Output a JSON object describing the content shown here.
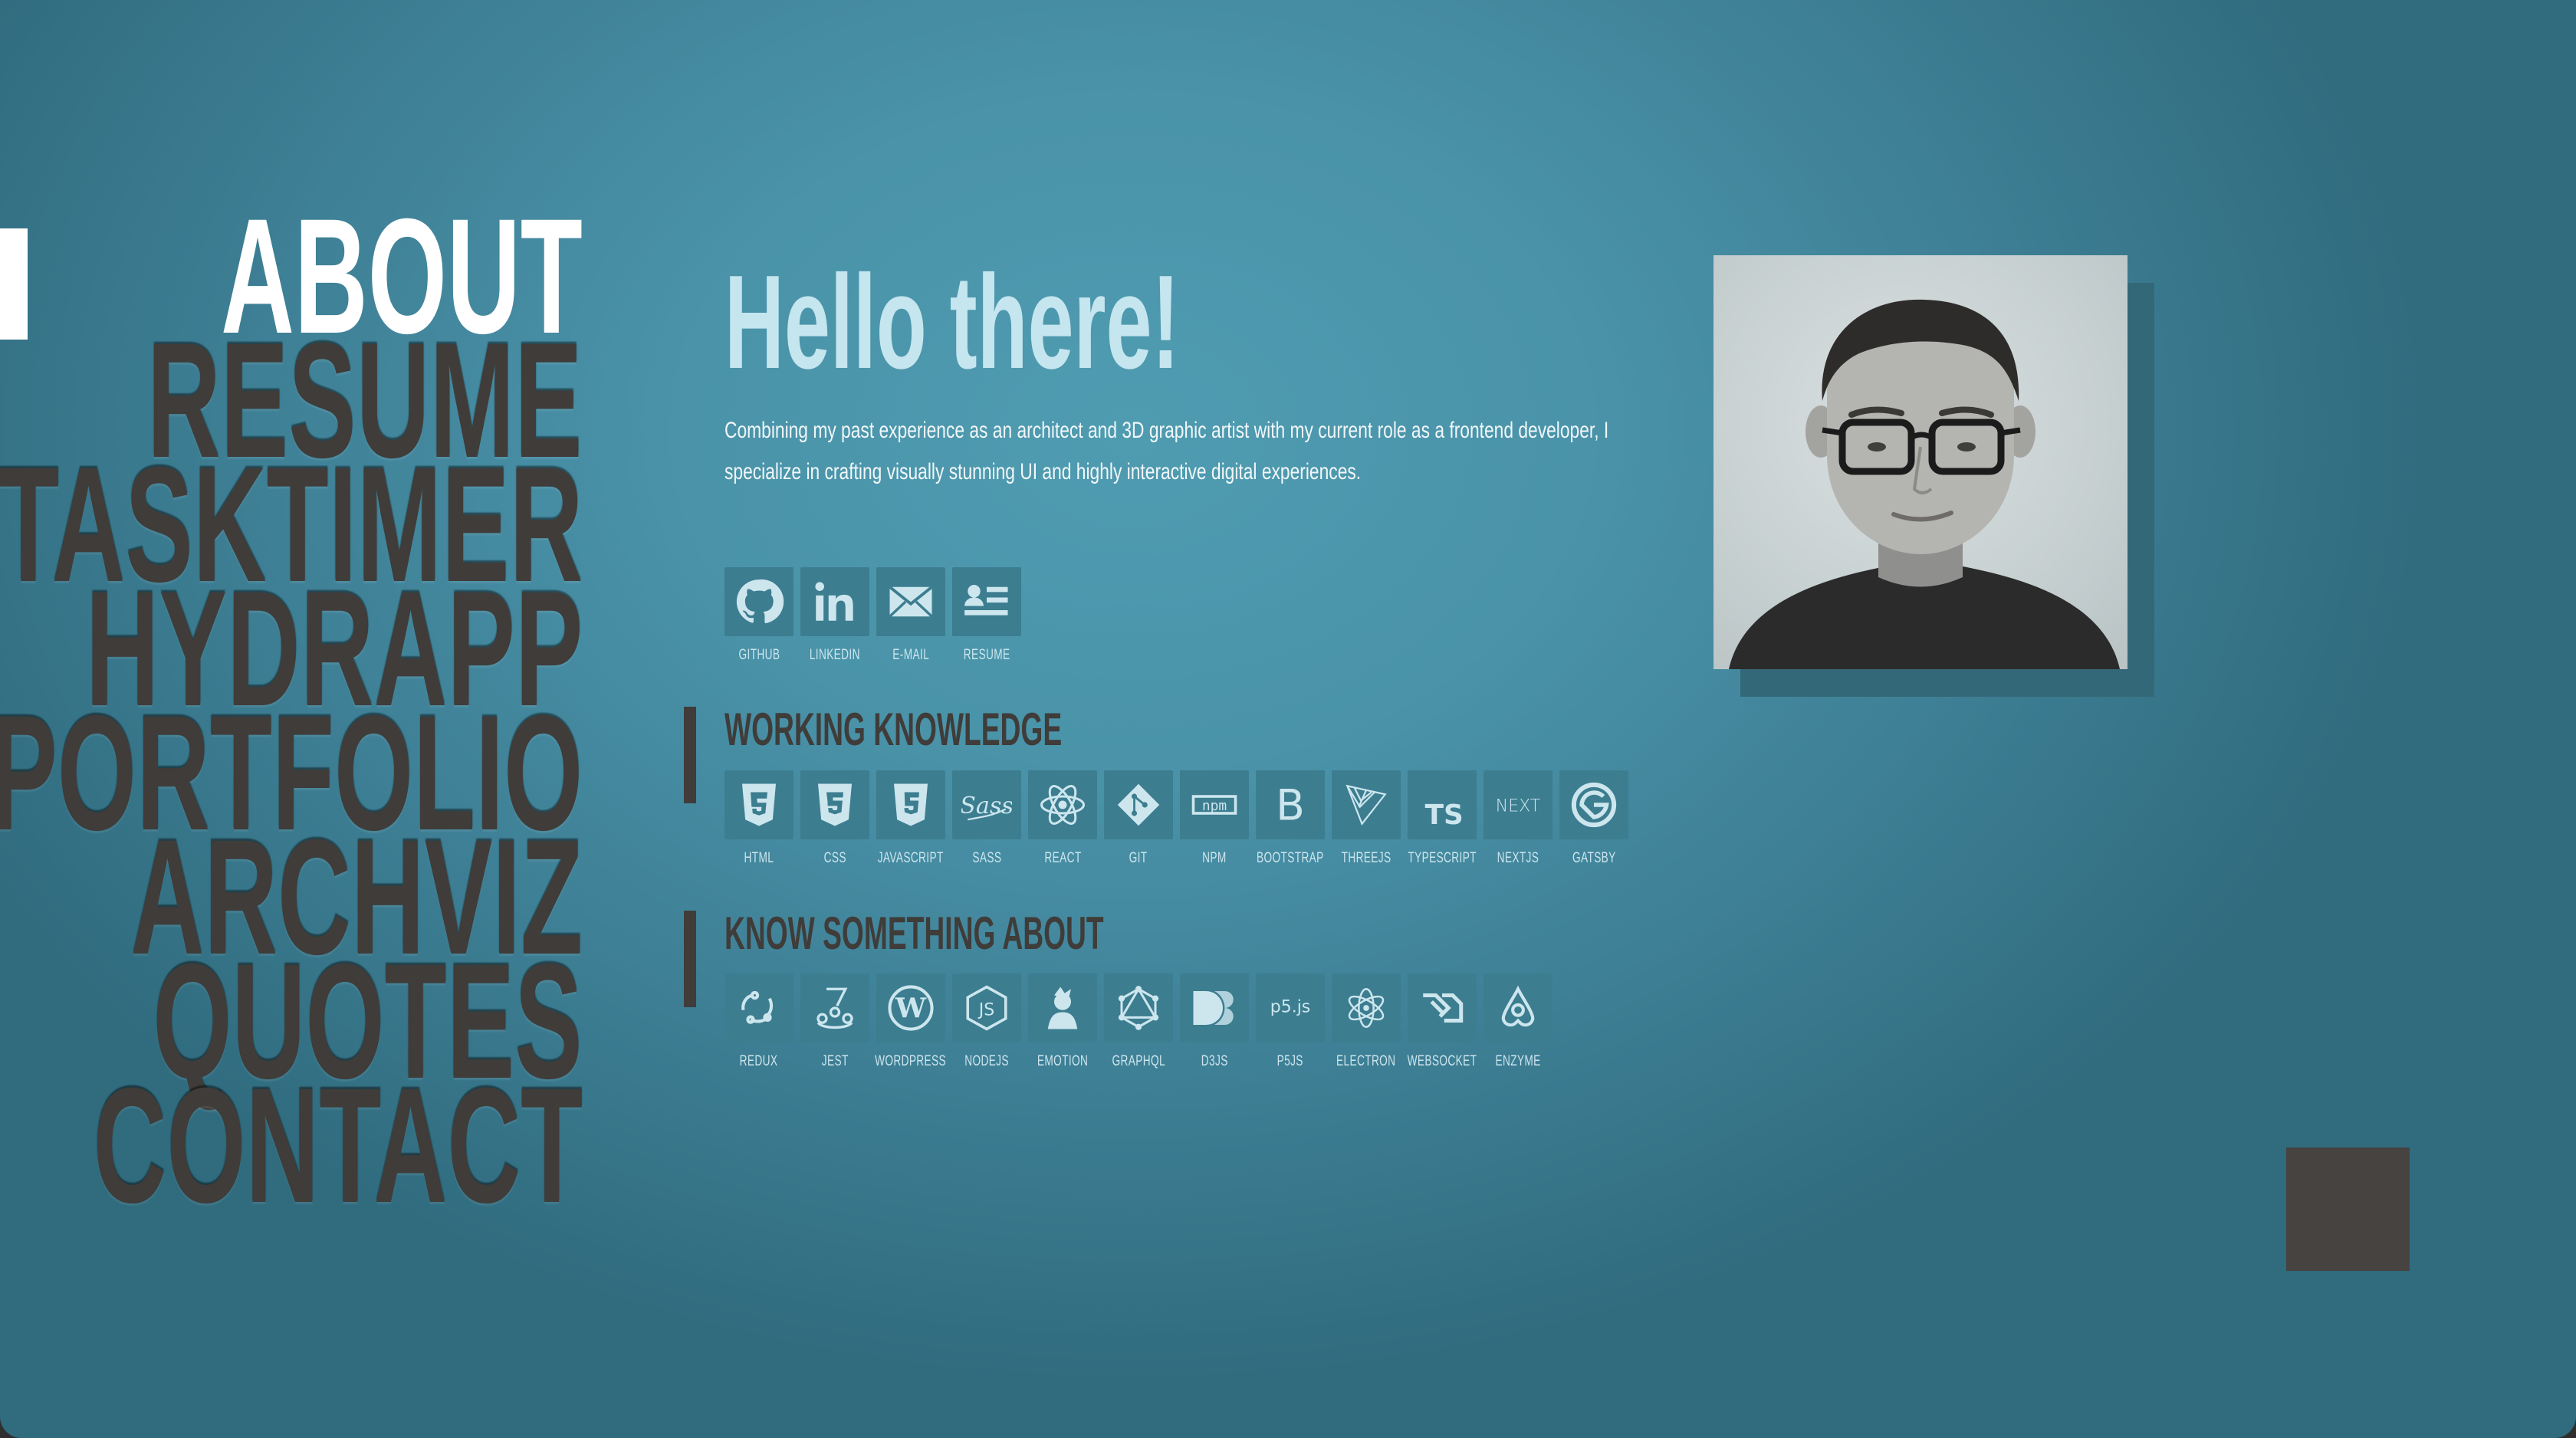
{
  "nav": {
    "items": [
      {
        "label": "ABOUT"
      },
      {
        "label": "RESUME"
      },
      {
        "label": "TASKTIMER"
      },
      {
        "label": "HYDRAPP"
      },
      {
        "label": "PORTFOLIO"
      },
      {
        "label": "ARCHVIZ"
      },
      {
        "label": "QUOTES"
      },
      {
        "label": "CONTACT"
      }
    ],
    "active": "ABOUT"
  },
  "about": {
    "title": "Hello there!",
    "intro": "Combining my past experience as an architect and 3D graphic artist with my current role as a frontend developer, I specialize in crafting visually stunning UI and highly interactive digital experiences."
  },
  "links": [
    {
      "label": "GITHUB",
      "icon": "github-icon"
    },
    {
      "label": "LINKEDIN",
      "icon": "linkedin-icon"
    },
    {
      "label": "E-MAIL",
      "icon": "email-icon"
    },
    {
      "label": "RESUME",
      "icon": "resume-icon"
    }
  ],
  "working": {
    "title": "WORKING KNOWLEDGE",
    "skills": [
      {
        "label": "HTML",
        "icon": "html5-icon"
      },
      {
        "label": "CSS",
        "icon": "css3-icon"
      },
      {
        "label": "JAVASCRIPT",
        "icon": "javascript-icon"
      },
      {
        "label": "SASS",
        "icon": "sass-icon"
      },
      {
        "label": "REACT",
        "icon": "react-icon"
      },
      {
        "label": "GIT",
        "icon": "git-icon"
      },
      {
        "label": "NPM",
        "icon": "npm-icon"
      },
      {
        "label": "BOOTSTRAP",
        "icon": "bootstrap-icon"
      },
      {
        "label": "THREEJS",
        "icon": "threejs-icon"
      },
      {
        "label": "TYPESCRIPT",
        "icon": "typescript-icon"
      },
      {
        "label": "NEXTJS",
        "icon": "nextjs-icon"
      },
      {
        "label": "GATSBY",
        "icon": "gatsby-icon"
      }
    ]
  },
  "know": {
    "title": "KNOW SOMETHING ABOUT",
    "skills": [
      {
        "label": "REDUX",
        "icon": "redux-icon"
      },
      {
        "label": "JEST",
        "icon": "jest-icon"
      },
      {
        "label": "WORDPRESS",
        "icon": "wordpress-icon"
      },
      {
        "label": "NODEJS",
        "icon": "nodejs-icon"
      },
      {
        "label": "EMOTION",
        "icon": "emotion-icon"
      },
      {
        "label": "GRAPHQL",
        "icon": "graphql-icon"
      },
      {
        "label": "D3JS",
        "icon": "d3js-icon"
      },
      {
        "label": "P5JS",
        "icon": "p5js-icon"
      },
      {
        "label": "ELECTRON",
        "icon": "electron-icon"
      },
      {
        "label": "WEBSOCKET",
        "icon": "websocket-icon"
      },
      {
        "label": "ENZYME",
        "icon": "enzyme-icon"
      }
    ]
  },
  "colors": {
    "accent_text": "#c5e5ef",
    "tile_bg": "#3c7d90",
    "dark": "#3f3c39"
  }
}
